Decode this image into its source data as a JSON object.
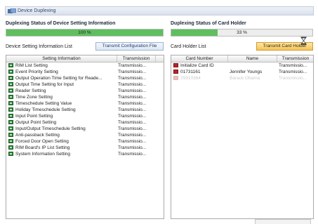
{
  "window": {
    "title": "Device Duplexing"
  },
  "left": {
    "section_title": "Duplexing Status of Device Setting Information",
    "progress": {
      "value": 1.0,
      "text": "100 %"
    },
    "list_label": "Device Setting Information List",
    "button_label": "Transmit Configuration File",
    "columns": [
      "Setting Information",
      "Transmission"
    ],
    "rows": [
      {
        "name": "RIM List Setting",
        "status": "Transmissio..."
      },
      {
        "name": "Event Priority Setting",
        "status": "Transmissio..."
      },
      {
        "name": "Output Operation Time Setting for Reade...",
        "status": "Transmissio..."
      },
      {
        "name": "Output Time Setting for Input",
        "status": "Transmissio..."
      },
      {
        "name": "Reader Setting",
        "status": "Transmissio..."
      },
      {
        "name": "Time Zone Setting",
        "status": "Transmissio..."
      },
      {
        "name": "Timeschedule Setting Value",
        "status": "Transmissio..."
      },
      {
        "name": "Holiday Timeschedule Setting",
        "status": "Transmissio..."
      },
      {
        "name": "Input Point Setting",
        "status": "Transmissio..."
      },
      {
        "name": "Output Point Setting",
        "status": "Transmissio..."
      },
      {
        "name": "Input/Output Timeschedule Setting",
        "status": "Transmissio..."
      },
      {
        "name": "Anti-passback Setting",
        "status": "Transmissio..."
      },
      {
        "name": "Forced Door Open Setting",
        "status": "Transmissio..."
      },
      {
        "name": "RIM Board's IP List Setting",
        "status": "Transmissio..."
      },
      {
        "name": "System Information Setting",
        "status": "Transmissio..."
      }
    ]
  },
  "right": {
    "section_title": "Duplexing Status of Card Holder",
    "progress": {
      "value": 0.33,
      "text": "33 %"
    },
    "list_label": "Card Holder List",
    "button_label": "Transmit Card Holder",
    "columns": [
      "Card Number",
      "Name",
      "Transmission"
    ],
    "rows": [
      {
        "card": "Initialize Card ID",
        "name": "",
        "status": "Transmissio...",
        "faded": false
      },
      {
        "card": "01731161",
        "name": "Jennifer Youngs",
        "status": "Transmissio...",
        "faded": false
      },
      {
        "card": "25910364",
        "name": "Barack Obama",
        "status": "Transmissio...",
        "faded": true
      }
    ]
  },
  "colors": {
    "progress_fill": "#5fbf5f",
    "accent_button": "#f5c35a"
  },
  "icons": {
    "setting_row": "settings-file-icon",
    "card_row": "card-holder-icon"
  }
}
